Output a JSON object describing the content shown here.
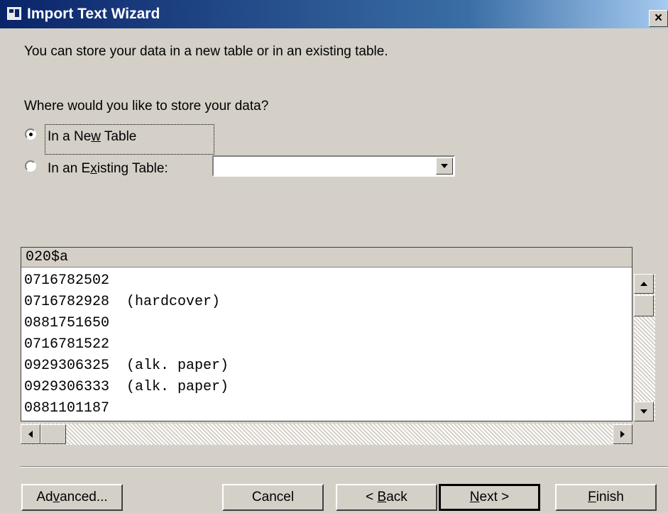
{
  "window": {
    "title": "Import Text Wizard",
    "close_label": "×"
  },
  "intro_text": "You can store your data in a new table or in an existing table.",
  "question": "Where would you like to store your data?",
  "options": {
    "new_table": {
      "pre": "In a Ne",
      "accel": "w",
      "post": " Table",
      "selected": true
    },
    "existing_table": {
      "pre": "In an E",
      "accel": "x",
      "post": "isting Table:",
      "selected": false,
      "value": ""
    }
  },
  "preview": {
    "header": "020$a",
    "rows": [
      "0716782502",
      "0716782928  (hardcover)",
      "0881751650",
      "0716781522",
      "0929306325  (alk. paper)",
      "0929306333  (alk. paper)",
      "0881101187"
    ]
  },
  "buttons": {
    "advanced": {
      "pre": "Ad",
      "accel": "v",
      "post": "anced..."
    },
    "cancel": {
      "label": "Cancel"
    },
    "back": {
      "pre": "< ",
      "accel": "B",
      "post": "ack"
    },
    "next": {
      "pre": "",
      "accel": "N",
      "post": "ext >"
    },
    "finish": {
      "pre": "",
      "accel": "F",
      "post": "inish"
    }
  }
}
